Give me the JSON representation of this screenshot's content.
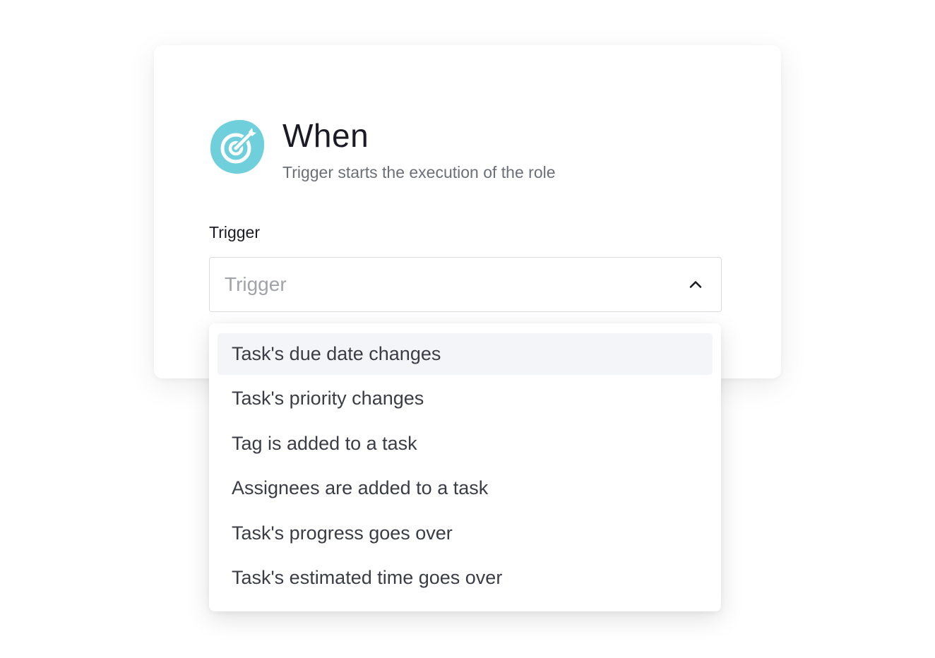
{
  "card": {
    "title": "When",
    "subtitle": "Trigger starts the execution of the role",
    "icon": "target-icon",
    "icon_color": "#6fd0dc"
  },
  "trigger_field": {
    "label": "Trigger",
    "placeholder": "Trigger",
    "chevron": "chevron-up-icon"
  },
  "dropdown": {
    "options": [
      "Task's due date changes",
      "Task's priority changes",
      "Tag is added to a task",
      "Assignees are added to a task",
      "Task's progress goes over",
      "Task's estimated time goes over"
    ],
    "highlighted_option": "Task's due date changes"
  }
}
